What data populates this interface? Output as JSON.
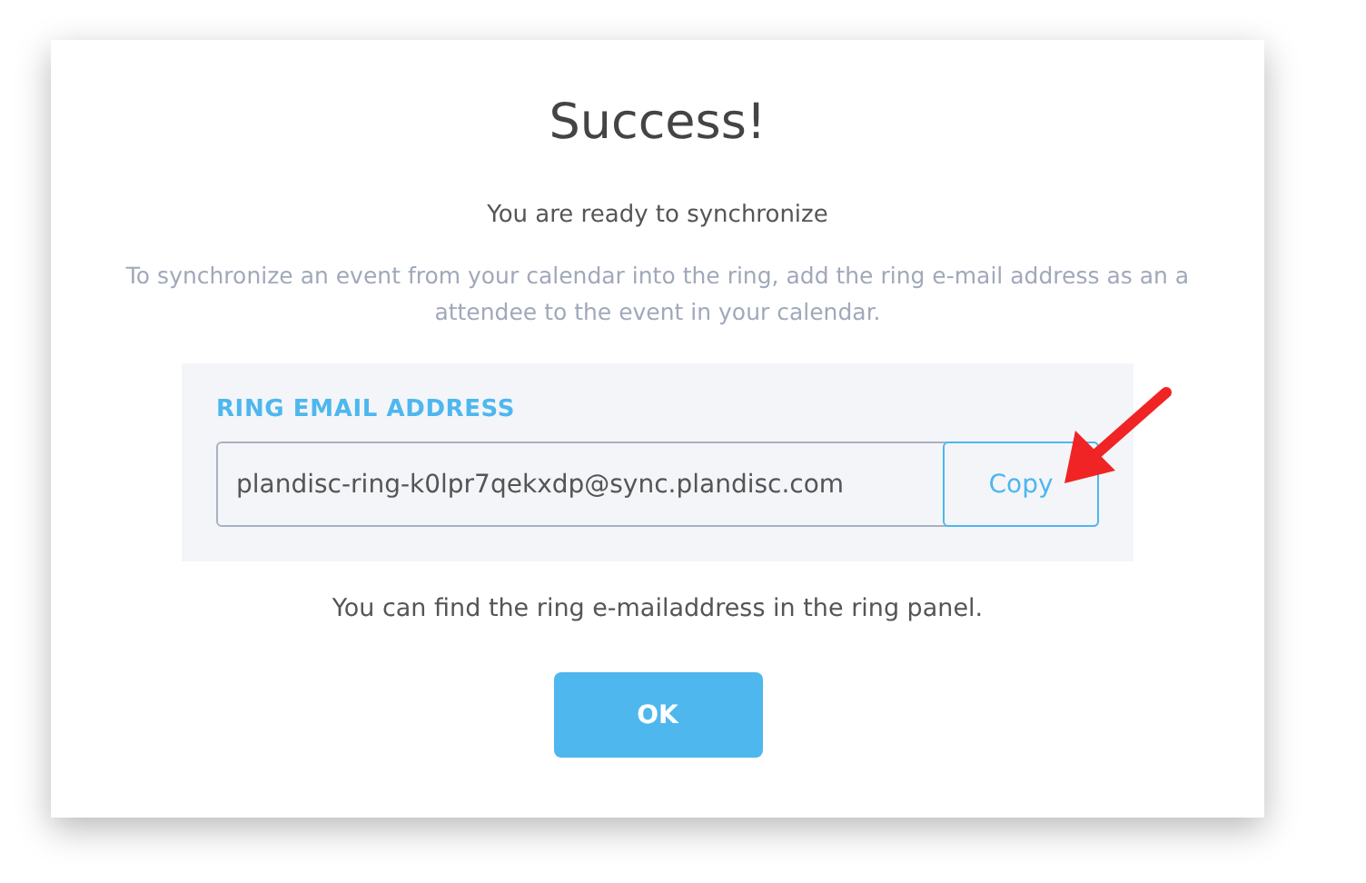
{
  "dialog": {
    "title": "Success!",
    "subtitle": "You are ready to synchronize",
    "description": "To synchronize an event from your calendar into the ring, add the ring e-mail address as an a attendee to the event in your calendar.",
    "email_panel": {
      "label": "RING EMAIL ADDRESS",
      "value": "plandisc-ring-k0lpr7qekxdp@sync.plandisc.com",
      "copy_button": "Copy"
    },
    "note": "You can find the ring e-mailaddress in the ring panel.",
    "buttons": [
      "OK"
    ]
  }
}
